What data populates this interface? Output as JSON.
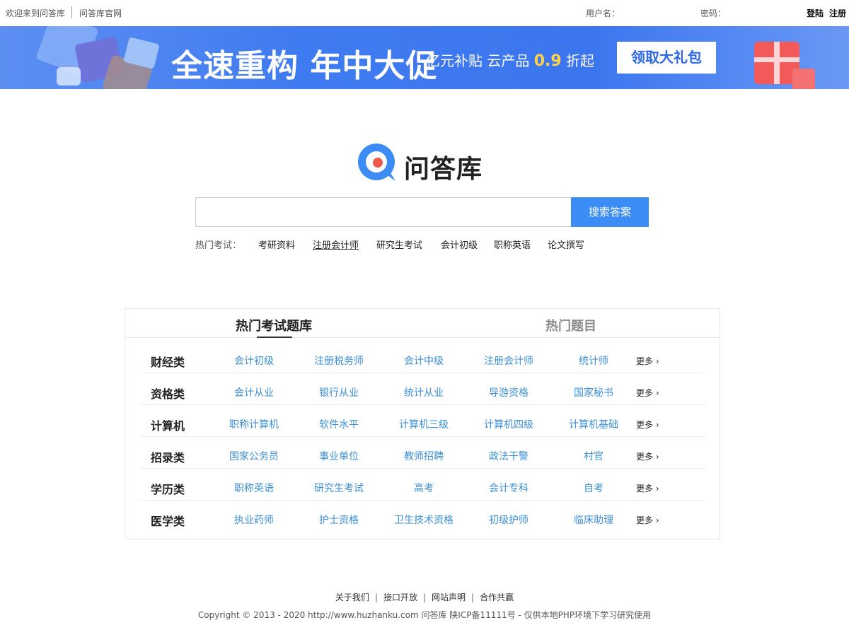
{
  "topbar": {
    "welcome": "欢迎来到问答库",
    "official_site": "问答库官网",
    "username_label": "用户名：",
    "password_label": "密码：",
    "login": "登陆",
    "register": "注册"
  },
  "banner": {
    "headline": "全速重构 年中大促",
    "sub_prefix": "亿元补贴 云产品 ",
    "sub_number": "0.9",
    "sub_suffix": " 折起",
    "cta": "领取大礼包"
  },
  "logo": {
    "name": "问答库"
  },
  "search": {
    "input_value": "",
    "button": "搜索答案"
  },
  "hot_exams": {
    "label": "热门考试：",
    "items": [
      "考研资料",
      "注册会计师",
      "研究生考试",
      "会计初级",
      "职称英语",
      "论文撰写"
    ]
  },
  "panel": {
    "tabs": [
      "热门考试题库",
      "热门题目"
    ],
    "more_label": "更多 ›",
    "rows": [
      {
        "category": "财经类",
        "items": [
          "会计初级",
          "注册税务师",
          "会计中级",
          "注册会计师",
          "统计师"
        ]
      },
      {
        "category": "资格类",
        "items": [
          "会计从业",
          "银行从业",
          "统计从业",
          "导游资格",
          "国家秘书"
        ]
      },
      {
        "category": "计算机",
        "items": [
          "职称计算机",
          "软件水平",
          "计算机三级",
          "计算机四级",
          "计算机基础"
        ]
      },
      {
        "category": "招录类",
        "items": [
          "国家公务员",
          "事业单位",
          "教师招聘",
          "政法干警",
          "村官"
        ]
      },
      {
        "category": "学历类",
        "items": [
          "职称英语",
          "研究生考试",
          "高考",
          "会计专科",
          "自考"
        ]
      },
      {
        "category": "医学类",
        "items": [
          "执业药师",
          "护士资格",
          "卫生技术资格",
          "初级护师",
          "临床助理"
        ]
      }
    ]
  },
  "footer": {
    "links": [
      "关于我们",
      "接口开放",
      "网站声明",
      "合作共赢"
    ],
    "copyright": "Copyright © 2013 - 2020 http://www.huzhanku.com  问答库   陕ICP备11111号 - 仅供本地PHP环境下学习研究使用"
  },
  "colors": {
    "accent": "#3b8cf5",
    "link": "#3b8fd6",
    "banner": "#3f7bf0",
    "cta_text": "#2c68e8",
    "logo_red": "#f15a4a"
  }
}
